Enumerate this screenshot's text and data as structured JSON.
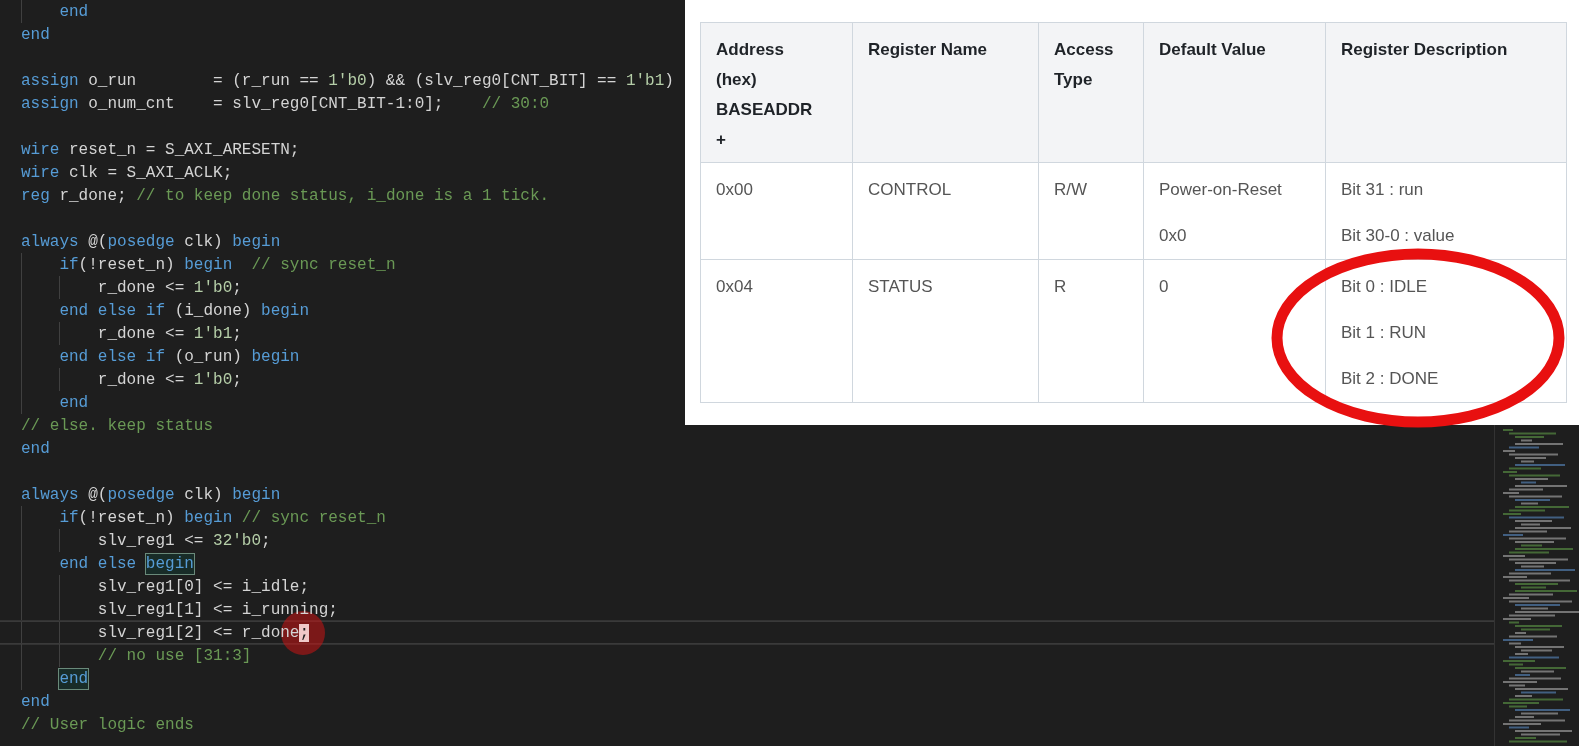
{
  "code_lines": [
    {
      "kind": "code",
      "segments": [
        {
          "kind": "kw",
          "text": "    end"
        }
      ]
    },
    {
      "kind": "code",
      "segments": [
        {
          "kind": "kw",
          "text": "end"
        }
      ]
    },
    {
      "kind": "blank"
    },
    {
      "kind": "code",
      "segments": [
        {
          "kind": "kw",
          "text": "assign"
        },
        {
          "kind": "id",
          "text": " o_run        = (r_run == "
        },
        {
          "kind": "num",
          "text": "1'b0"
        },
        {
          "kind": "id",
          "text": ") && (slv_reg0[CNT_BIT] == "
        },
        {
          "kind": "num",
          "text": "1'b1"
        },
        {
          "kind": "id",
          "text": ")"
        }
      ]
    },
    {
      "kind": "code",
      "segments": [
        {
          "kind": "kw",
          "text": "assign"
        },
        {
          "kind": "id",
          "text": " o_num_cnt    = slv_reg0[CNT_BIT-1:0];    "
        },
        {
          "kind": "cm",
          "text": "// 30:0"
        }
      ]
    },
    {
      "kind": "blank"
    },
    {
      "kind": "code",
      "segments": [
        {
          "kind": "kw",
          "text": "wire"
        },
        {
          "kind": "id",
          "text": " reset_n = S_AXI_ARESETN;"
        }
      ]
    },
    {
      "kind": "code",
      "segments": [
        {
          "kind": "kw",
          "text": "wire"
        },
        {
          "kind": "id",
          "text": " clk = S_AXI_ACLK;"
        }
      ]
    },
    {
      "kind": "code",
      "segments": [
        {
          "kind": "kw",
          "text": "reg"
        },
        {
          "kind": "id",
          "text": " r_done; "
        },
        {
          "kind": "cm",
          "text": "// to keep done status, i_done is a 1 tick."
        }
      ]
    },
    {
      "kind": "blank"
    },
    {
      "kind": "code",
      "segments": [
        {
          "kind": "kw",
          "text": "always"
        },
        {
          "kind": "id",
          "text": " @("
        },
        {
          "kind": "kw",
          "text": "posedge"
        },
        {
          "kind": "id",
          "text": " clk) "
        },
        {
          "kind": "kw",
          "text": "begin"
        }
      ]
    },
    {
      "kind": "code",
      "segments": [
        {
          "kind": "kw",
          "text": "    if"
        },
        {
          "kind": "id",
          "text": "(!reset_n) "
        },
        {
          "kind": "kw",
          "text": "begin"
        },
        {
          "kind": "cm",
          "text": "  // sync reset_n"
        }
      ]
    },
    {
      "kind": "code",
      "segments": [
        {
          "kind": "id",
          "text": "        r_done <= "
        },
        {
          "kind": "num",
          "text": "1'b0"
        },
        {
          "kind": "id",
          "text": ";"
        }
      ]
    },
    {
      "kind": "code",
      "segments": [
        {
          "kind": "kw",
          "text": "    end else if"
        },
        {
          "kind": "id",
          "text": " (i_done) "
        },
        {
          "kind": "kw",
          "text": "begin"
        }
      ]
    },
    {
      "kind": "code",
      "segments": [
        {
          "kind": "id",
          "text": "        r_done <= "
        },
        {
          "kind": "num",
          "text": "1'b1"
        },
        {
          "kind": "id",
          "text": ";"
        }
      ]
    },
    {
      "kind": "code",
      "segments": [
        {
          "kind": "kw",
          "text": "    end else if"
        },
        {
          "kind": "id",
          "text": " (o_run) "
        },
        {
          "kind": "kw",
          "text": "begin"
        }
      ]
    },
    {
      "kind": "code",
      "segments": [
        {
          "kind": "id",
          "text": "        r_done <= "
        },
        {
          "kind": "num",
          "text": "1'b0"
        },
        {
          "kind": "id",
          "text": ";"
        }
      ]
    },
    {
      "kind": "code",
      "segments": [
        {
          "kind": "kw",
          "text": "    end"
        }
      ]
    },
    {
      "kind": "code",
      "segments": [
        {
          "kind": "cm",
          "text": "// else. keep status"
        }
      ]
    },
    {
      "kind": "code",
      "segments": [
        {
          "kind": "kw",
          "text": "end"
        }
      ]
    },
    {
      "kind": "blank"
    },
    {
      "kind": "code",
      "segments": [
        {
          "kind": "kw",
          "text": "always"
        },
        {
          "kind": "id",
          "text": " @("
        },
        {
          "kind": "kw",
          "text": "posedge"
        },
        {
          "kind": "id",
          "text": " clk) "
        },
        {
          "kind": "kw",
          "text": "begin"
        }
      ]
    },
    {
      "kind": "code",
      "segments": [
        {
          "kind": "kw",
          "text": "    if"
        },
        {
          "kind": "id",
          "text": "(!reset_n) "
        },
        {
          "kind": "kw",
          "text": "begin"
        },
        {
          "kind": "cm",
          "text": " // sync reset_n"
        }
      ]
    },
    {
      "kind": "code",
      "segments": [
        {
          "kind": "id",
          "text": "        slv_reg1 <= "
        },
        {
          "kind": "num",
          "text": "32'b0"
        },
        {
          "kind": "id",
          "text": ";"
        }
      ]
    },
    {
      "kind": "code",
      "segments": [
        {
          "kind": "kw",
          "text": "    end else "
        },
        {
          "kind": "kw",
          "text": "begin",
          "matched": true
        }
      ]
    },
    {
      "kind": "code",
      "segments": [
        {
          "kind": "id",
          "text": "        slv_reg1[0] <= i_idle;"
        }
      ]
    },
    {
      "kind": "code",
      "segments": [
        {
          "kind": "id",
          "text": "        slv_reg1[1] <= i_running;"
        }
      ]
    },
    {
      "kind": "code",
      "current": true,
      "segments": [
        {
          "kind": "id",
          "text": "        slv_reg1[2] <= r_done"
        },
        {
          "kind": "id",
          "text": ";",
          "cursor": true,
          "clicked": true
        }
      ]
    },
    {
      "kind": "code",
      "segments": [
        {
          "kind": "cm",
          "text": "        // no use [31:3]"
        }
      ]
    },
    {
      "kind": "code",
      "segments": [
        {
          "kind": "kw",
          "text": "    end",
          "matched": true
        }
      ]
    },
    {
      "kind": "code",
      "segments": [
        {
          "kind": "kw",
          "text": "end"
        }
      ]
    },
    {
      "kind": "code",
      "segments": [
        {
          "kind": "cm",
          "text": "// User logic ends"
        }
      ]
    }
  ],
  "register_table": {
    "columns": [
      "Address\n(hex)\nBASEADDR\n+",
      "Register Name",
      "Access Type",
      "Default Value",
      "Register Description"
    ],
    "rows": [
      {
        "cells": [
          [
            "0x00"
          ],
          [
            "CONTROL"
          ],
          [
            "R/W"
          ],
          [
            "Power-on-Reset",
            "0x0"
          ],
          [
            "Bit 31 : run",
            "Bit 30-0 : value"
          ]
        ]
      },
      {
        "cells": [
          [
            "0x04"
          ],
          [
            "STATUS"
          ],
          [
            "R"
          ],
          [
            "0"
          ],
          [
            "Bit 0 : IDLE",
            "Bit 1 : RUN",
            "Bit 2 : DONE"
          ]
        ]
      }
    ]
  }
}
